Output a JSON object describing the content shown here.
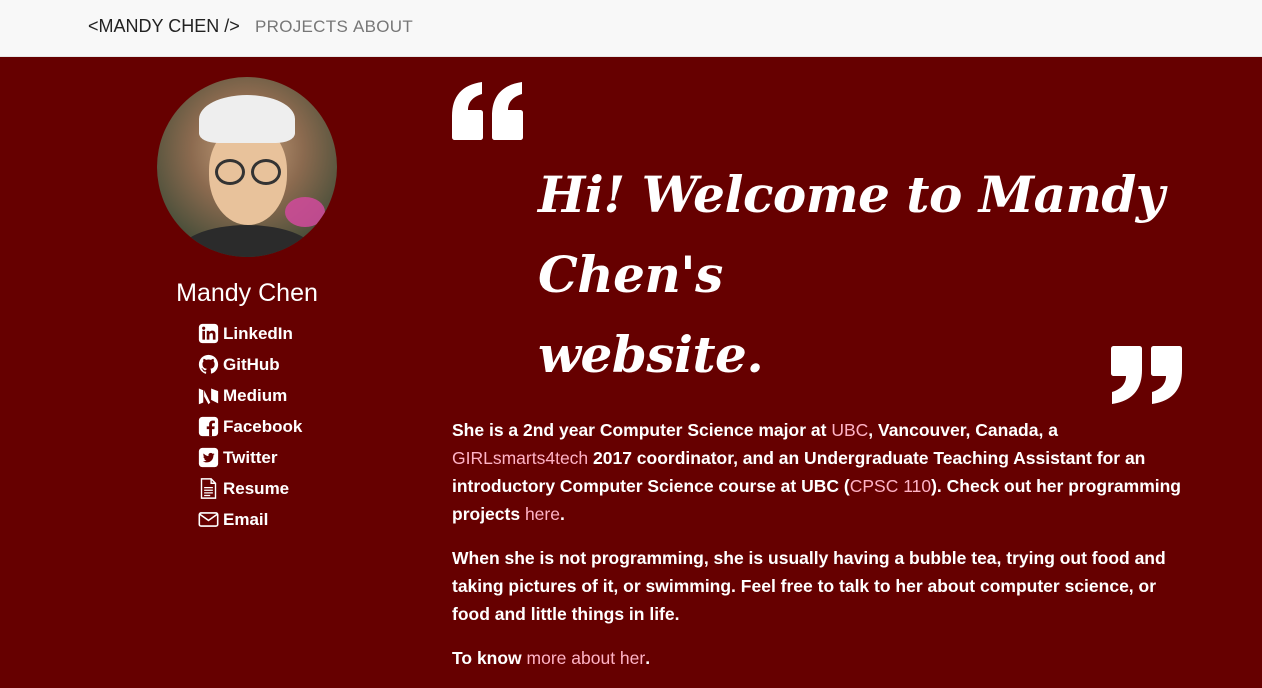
{
  "nav": {
    "brand": "<MANDY CHEN />",
    "links": [
      "PROJECTS",
      "ABOUT"
    ]
  },
  "profile": {
    "name": "Mandy Chen",
    "social": [
      {
        "label": "LinkedIn",
        "icon": "linkedin-icon"
      },
      {
        "label": "GitHub",
        "icon": "github-icon"
      },
      {
        "label": "Medium",
        "icon": "medium-icon"
      },
      {
        "label": "Facebook",
        "icon": "facebook-icon"
      },
      {
        "label": "Twitter",
        "icon": "twitter-icon"
      },
      {
        "label": "Resume",
        "icon": "document-icon"
      },
      {
        "label": "Email",
        "icon": "envelope-icon"
      }
    ]
  },
  "welcome": {
    "line1": "Hi! Welcome to Mandy Chen's",
    "line2": "website."
  },
  "bio": {
    "p1_a": "She is a 2nd year Computer Science major at ",
    "p1_link1": "UBC",
    "p1_b": ", Vancouver, Canada, a ",
    "p1_link2": "GIRLsmarts4tech",
    "p1_c": " 2017 coordinator, and an Undergraduate Teaching Assistant for an introductory Computer Science course at UBC (",
    "p1_link3": "CPSC 110",
    "p1_d": "). Check out her programming projects ",
    "p1_link4": "here",
    "p1_e": ".",
    "p2": "When she is not programming, she is usually having a bubble tea, trying out food and taking pictures of it, or swimming. Feel free to talk to her about computer science, or food and little things in life.",
    "p3_a": "To know ",
    "p3_link": "more about her",
    "p3_b": "."
  },
  "colors": {
    "background": "#660000",
    "navbar": "#f8f8f8",
    "link": "#ffb3c6",
    "text": "#ffffff"
  }
}
